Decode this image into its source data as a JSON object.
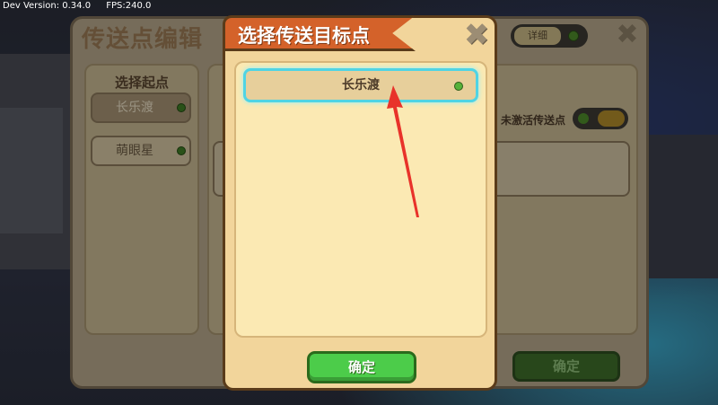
{
  "debug": {
    "version": "Dev Version: 0.34.0",
    "fps": "FPS:240.0"
  },
  "back_panel": {
    "title": "传送点编辑",
    "detail_button": "详细",
    "start_section_title": "选择起点",
    "start_points": [
      {
        "label": "长乐渡",
        "active": true
      },
      {
        "label": "萌眼星",
        "active": false
      }
    ],
    "inactive_label": "未激活传送点",
    "confirm_label": "确定"
  },
  "modal": {
    "title": "选择传送目标点",
    "destinations": [
      {
        "label": "长乐渡",
        "selected": true
      }
    ],
    "confirm_label": "确定"
  },
  "colors": {
    "ribbon": "#d4622a",
    "modal_bg": "#f2d59b",
    "selection_glow": "#4fd4e4",
    "confirm_green": "#4ccc4a",
    "annotation_arrow": "#e8322a"
  }
}
